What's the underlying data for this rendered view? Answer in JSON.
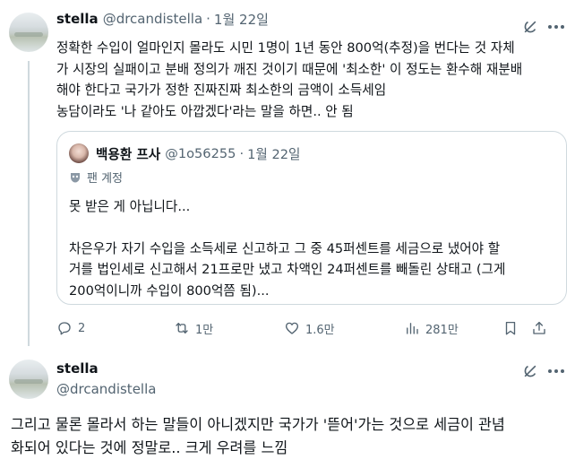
{
  "post1": {
    "name": "stella",
    "handle": "@drcandistella",
    "separator": "·",
    "date": "1월 22일",
    "text_lines": [
      "정확한 수입이 얼마인지 몰라도 시민 1명이 1년 동안 800억(추정)을 번다는 것 자체",
      "가 시장의 실패이고 분배 정의가 깨진 것이기 때문에 '최소한' 이 정도는 환수해 재분배",
      "해야 한다고 국가가 정한 진짜진짜 최소한의 금액이 소득세임",
      "농담이라도 '나 같아도 아깝겠다'라는 말을 하면.. 안 됨"
    ],
    "quote": {
      "name": "백용환 프사",
      "handle": "@1o56255",
      "separator": "·",
      "date": "1월 22일",
      "label": "팬 계정",
      "lines_a": [
        "못 받은 게 아닙니다..."
      ],
      "lines_b": [
        "차은우가 자기 수입을 소득세로 신고하고 그 중 45퍼센트를 세금으로 냈어야 할",
        "거를 법인세로 신고해서 21프로만 냈고 차액인 24퍼센트를 빼돌린 상태고 (그게",
        "200억이니까 수입이 800억쯤 됨)..."
      ]
    },
    "actions": {
      "replies": "2",
      "reposts": "1만",
      "likes": "1.6만",
      "views": "281만"
    }
  },
  "post2": {
    "name": "stella",
    "handle": "@drcandistella",
    "text_lines": [
      "그리고 물론 몰라서 하는 말들이 아니겠지만 국가가 '뜯어'가는 것으로 세금이 관념",
      "화되어 있다는 것에 정말로.. 크게 우려를 느낌"
    ]
  },
  "icons": {
    "grok": "grok-icon",
    "more": "more-icon",
    "reply": "reply-icon",
    "repost": "repost-icon",
    "like": "heart-icon",
    "views": "views-chart-icon",
    "bookmark": "bookmark-icon",
    "share": "share-icon",
    "label": "mask-icon"
  },
  "colors": {
    "text": "#0f1419",
    "secondary": "#536471",
    "border": "#cfd9de"
  }
}
